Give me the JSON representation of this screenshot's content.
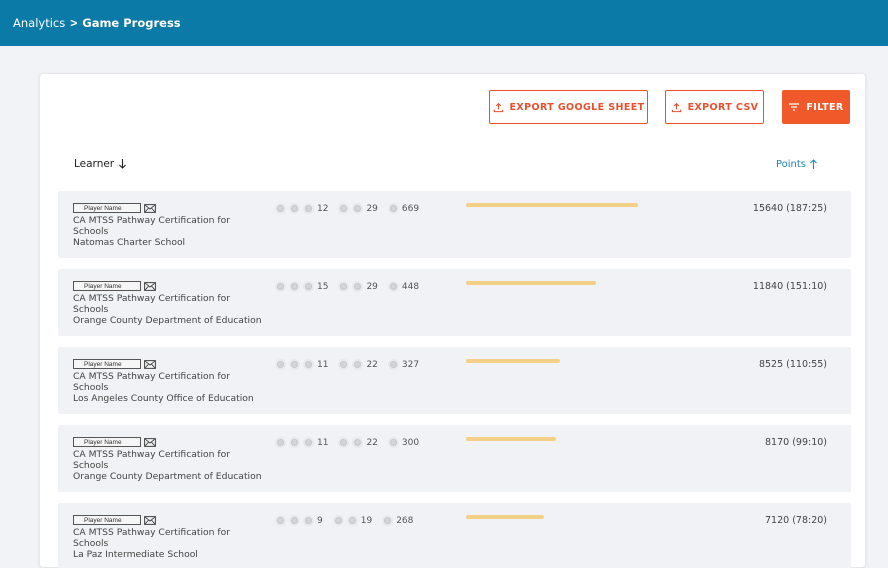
{
  "breadcrumb": {
    "parent": "Analytics",
    "separator": ">",
    "current": "Game Progress"
  },
  "toolbar": {
    "export_sheet_label": "EXPORT GOOGLE SHEET",
    "export_csv_label": "EXPORT CSV",
    "filter_label": "FILTER"
  },
  "columns": {
    "learner": "Learner",
    "points": "Points"
  },
  "colors": {
    "topbar": "#0c7aa6",
    "accent": "#f05a2b",
    "progress": "#f4cf86",
    "sort_link": "#1f86c4"
  },
  "rows": [
    {
      "player": "Player Name",
      "course": "CA MTSS Pathway Certification for Schools",
      "org": "Natomas Charter School",
      "s1": "12",
      "s2": "29",
      "s3": "669",
      "progress": 0.215,
      "points": "15640 (187:25)"
    },
    {
      "player": "Player Name",
      "course": "CA MTSS Pathway Certification for Schools",
      "org": "Orange County Department of Education",
      "s1": "15",
      "s2": "29",
      "s3": "448",
      "progress": 0.163,
      "points": "11840 (151:10)"
    },
    {
      "player": "Player Name",
      "course": "CA MTSS Pathway Certification for Schools",
      "org": "Los Angeles County Office of Education",
      "s1": "11",
      "s2": "22",
      "s3": "327",
      "progress": 0.117,
      "points": "8525 (110:55)"
    },
    {
      "player": "Player Name",
      "course": "CA MTSS Pathway Certification for Schools",
      "org": "Orange County Department of Education",
      "s1": "11",
      "s2": "22",
      "s3": "300",
      "progress": 0.112,
      "points": "8170 (99:10)"
    },
    {
      "player": "Player Name",
      "course": "CA MTSS Pathway Certification for Schools",
      "org": "La Paz Intermediate School",
      "s1": "9",
      "s2": "19",
      "s3": "268",
      "progress": 0.098,
      "points": "7120 (78:20)"
    }
  ]
}
